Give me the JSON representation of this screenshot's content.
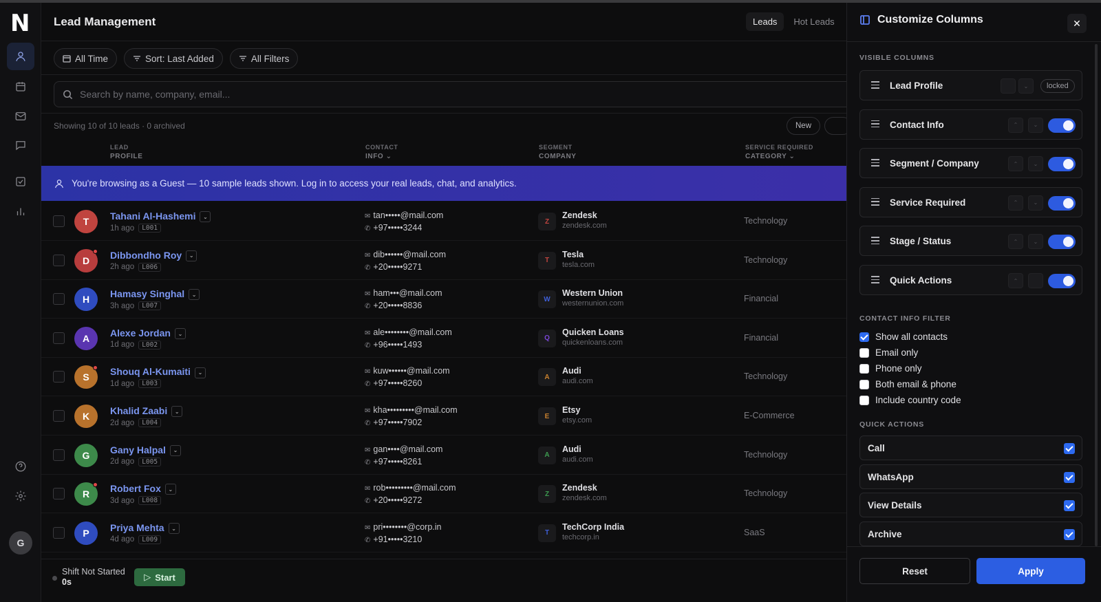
{
  "app": {
    "logo": "N",
    "title": "Lead Management"
  },
  "nav": {
    "items": [
      {
        "icon": "user-icon",
        "active": true
      },
      {
        "icon": "calendar-icon"
      },
      {
        "icon": "mail-icon"
      },
      {
        "icon": "chat-icon"
      },
      {
        "icon": "checkbox-icon"
      },
      {
        "icon": "chart-icon"
      }
    ],
    "help_icon": "help-icon",
    "settings_icon": "gear-icon",
    "avatar_initial": "G"
  },
  "header": {
    "tabs": [
      {
        "label": "Leads",
        "active": true
      },
      {
        "label": "Hot Leads"
      }
    ]
  },
  "filters": {
    "time": "All Time",
    "sort": "Sort: Last Added",
    "all": "All Filters"
  },
  "search": {
    "placeholder": "Search by name, company, email..."
  },
  "showing": "Showing 10 of 10 leads · 0 archived",
  "new_label": "New",
  "table": {
    "columns": [
      {
        "top": "LEAD",
        "sub": "PROFILE"
      },
      {
        "top": "CONTACT",
        "sub": "INFO ⌄"
      },
      {
        "top": "SEGMENT",
        "sub": "COMPANY"
      },
      {
        "top": "SERVICE REQUIRED",
        "sub": "CATEGORY ⌄"
      }
    ]
  },
  "banner": "You're browsing as a Guest — 10 sample leads shown. Log in to access your real leads, chat, and analytics.",
  "leads": [
    {
      "initial": "T",
      "color": "#c0443f",
      "dot": false,
      "name": "Tahani Al-Hashemi",
      "time": "1h ago",
      "code": "L001",
      "email": "tan•••••@mail.com",
      "phone": "+97•••••3244",
      "seg_initial": "Z",
      "seg_color": "#c0443f",
      "company": "Zendesk",
      "domain": "zendesk.com",
      "category": "Technology"
    },
    {
      "initial": "D",
      "color": "#b83d3d",
      "dot": true,
      "name": "Dibbondho Roy",
      "time": "2h ago",
      "code": "L006",
      "email": "dib••••••@mail.com",
      "phone": "+20•••••9271",
      "seg_initial": "T",
      "seg_color": "#c0443f",
      "company": "Tesla",
      "domain": "tesla.com",
      "category": "Technology"
    },
    {
      "initial": "H",
      "color": "#2f4cbf",
      "dot": false,
      "name": "Hamasy Singhal",
      "time": "3h ago",
      "code": "L007",
      "email": "ham•••@mail.com",
      "phone": "+20•••••8836",
      "seg_initial": "W",
      "seg_color": "#3e5ed6",
      "company": "Western Union",
      "domain": "westernunion.com",
      "category": "Financial"
    },
    {
      "initial": "A",
      "color": "#5a35b0",
      "dot": false,
      "name": "Alexe Jordan",
      "time": "1d ago",
      "code": "L002",
      "email": "ale••••••••@mail.com",
      "phone": "+96•••••1493",
      "seg_initial": "Q",
      "seg_color": "#7a46d6",
      "company": "Quicken Loans",
      "domain": "quickenloans.com",
      "category": "Financial"
    },
    {
      "initial": "S",
      "color": "#b8722c",
      "dot": true,
      "name": "Shouq Al-Kumaiti",
      "time": "1d ago",
      "code": "L003",
      "email": "kuw••••••@mail.com",
      "phone": "+97•••••8260",
      "seg_initial": "A",
      "seg_color": "#c8802e",
      "company": "Audi",
      "domain": "audi.com",
      "category": "Technology"
    },
    {
      "initial": "K",
      "color": "#b8722c",
      "dot": false,
      "name": "Khalid Zaabi",
      "time": "2d ago",
      "code": "L004",
      "email": "kha•••••••••@mail.com",
      "phone": "+97•••••7902",
      "seg_initial": "E",
      "seg_color": "#c8802e",
      "company": "Etsy",
      "domain": "etsy.com",
      "category": "E-Commerce"
    },
    {
      "initial": "G",
      "color": "#3d8a4a",
      "dot": false,
      "name": "Gany Halpal",
      "time": "2d ago",
      "code": "L005",
      "email": "gan••••@mail.com",
      "phone": "+97•••••8261",
      "seg_initial": "A",
      "seg_color": "#3d9a50",
      "company": "Audi",
      "domain": "audi.com",
      "category": "Technology"
    },
    {
      "initial": "R",
      "color": "#3d8a4a",
      "dot": true,
      "name": "Robert Fox",
      "time": "3d ago",
      "code": "L008",
      "email": "rob•••••••••@mail.com",
      "phone": "+20•••••9272",
      "seg_initial": "Z",
      "seg_color": "#3d9a50",
      "company": "Zendesk",
      "domain": "zendesk.com",
      "category": "Technology"
    },
    {
      "initial": "P",
      "color": "#2f4cbf",
      "dot": false,
      "name": "Priya Mehta",
      "time": "4d ago",
      "code": "L009",
      "email": "pri••••••••@corp.in",
      "phone": "+91•••••3210",
      "seg_initial": "T",
      "seg_color": "#3e5ed6",
      "company": "TechCorp India",
      "domain": "techcorp.in",
      "category": "SaaS"
    }
  ],
  "footer": {
    "shift_status": "Shift Not Started",
    "shift_time": "0s",
    "start_label": "Start"
  },
  "panel": {
    "title": "Customize Columns",
    "visible_heading": "VISIBLE COLUMNS",
    "locked_label": "locked",
    "columns": [
      {
        "label": "Lead Profile",
        "locked": true
      },
      {
        "label": "Contact Info",
        "on": true
      },
      {
        "label": "Segment / Company",
        "on": true
      },
      {
        "label": "Service Required",
        "on": true
      },
      {
        "label": "Stage / Status",
        "on": true
      },
      {
        "label": "Quick Actions",
        "on": true
      }
    ],
    "contact_heading": "CONTACT INFO FILTER",
    "contact_filters": [
      {
        "label": "Show all contacts",
        "checked": true
      },
      {
        "label": "Email only",
        "checked": false
      },
      {
        "label": "Phone only",
        "checked": false
      },
      {
        "label": "Both email & phone",
        "checked": false
      },
      {
        "label": "Include country code",
        "checked": false
      }
    ],
    "actions_heading": "QUICK ACTIONS",
    "actions": [
      {
        "label": "Call",
        "checked": true
      },
      {
        "label": "WhatsApp",
        "checked": true
      },
      {
        "label": "View Details",
        "checked": true
      },
      {
        "label": "Archive",
        "checked": true
      }
    ],
    "reset_label": "Reset",
    "apply_label": "Apply"
  }
}
